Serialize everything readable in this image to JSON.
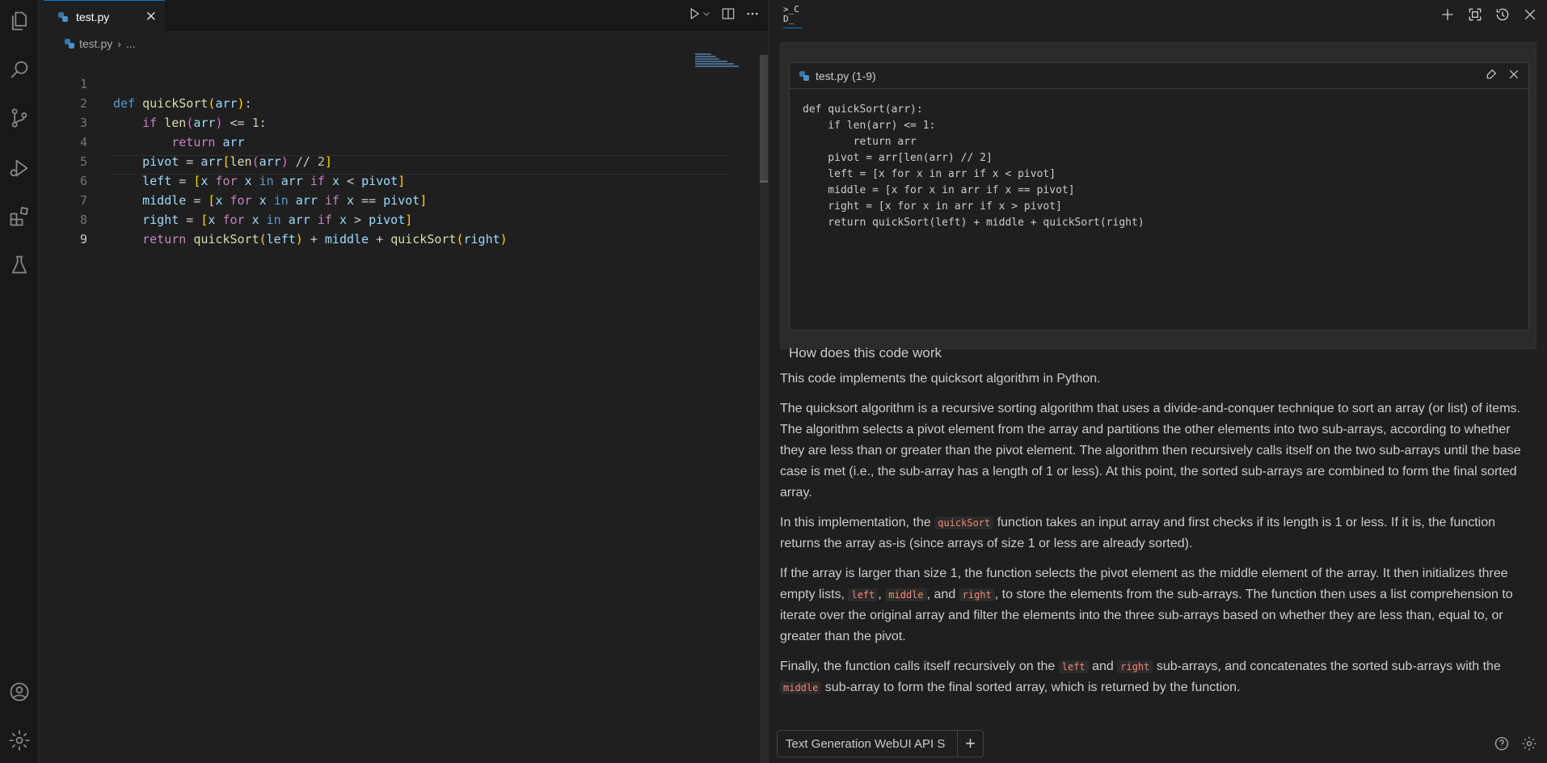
{
  "editor": {
    "tab_label": "test.py",
    "tab_close": "✕",
    "breadcrumb_file": "test.py",
    "breadcrumb_sep": "›",
    "breadcrumb_more": "...",
    "line_numbers": [
      "1",
      "2",
      "3",
      "4",
      "5",
      "6",
      "7",
      "8",
      "9"
    ]
  },
  "panel": {
    "logo_text": ">_C\nD_",
    "snippet_title": "test.py (1-9)",
    "snippet_code": "def quickSort(arr):\n    if len(arr) <= 1:\n        return arr\n    pivot = arr[len(arr) // 2]\n    left = [x for x in arr if x < pivot]\n    middle = [x for x in arr if x == pivot]\n    right = [x for x in arr if x > pivot]\n    return quickSort(left) + middle + quickSort(right)",
    "question": "How does this code work",
    "answer": {
      "p1": "This code implements the quicksort algorithm in Python.",
      "p2": "The quicksort algorithm is a recursive sorting algorithm that uses a divide-and-conquer technique to sort an array (or list) of items. The algorithm selects a pivot element from the array and partitions the other elements into two sub-arrays, according to whether they are less than or greater than the pivot element. The algorithm then recursively calls itself on the two sub-arrays until the base case is met (i.e., the sub-array has a length of 1 or less). At this point, the sorted sub-arrays are combined to form the final sorted array.",
      "p3_a": "In this implementation, the ",
      "p3_code": "quickSort",
      "p3_b": " function takes an input array and first checks if its length is 1 or less. If it is, the function returns the array as-is (since arrays of size 1 or less are already sorted).",
      "p4_a": "If the array is larger than size 1, the function selects the pivot element as the middle element of the array. It then initializes three empty lists, ",
      "p4_code1": "left",
      "p4_sep1": ", ",
      "p4_code2": "middle",
      "p4_sep2": ", and ",
      "p4_code3": "right",
      "p4_b": ", to store the elements from the sub-arrays. The function then uses a list comprehension to iterate over the original array and filter the elements into the three sub-arrays based on whether they are less than, equal to, or greater than the pivot.",
      "p5_a": "Finally, the function calls itself recursively on the ",
      "p5_code1": "left",
      "p5_sep1": " and ",
      "p5_code2": "right",
      "p5_b": " sub-arrays, and concatenates the sorted sub-arrays with the ",
      "p5_code3": "middle",
      "p5_c": " sub-array to form the final sorted array, which is returned by the function."
    },
    "chip_label": "Text Generation WebUI API S",
    "chip_add": "+"
  },
  "colors": {
    "accent": "#0078d4",
    "background": "#1f1f1f",
    "inline_code": "#f48771"
  }
}
